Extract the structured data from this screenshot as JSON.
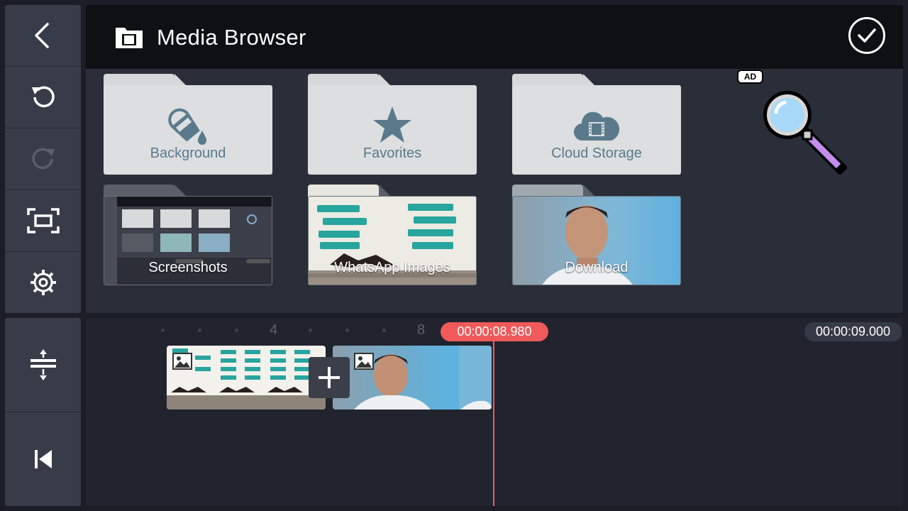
{
  "header": {
    "title": "Media Browser"
  },
  "sidebar": {
    "top_items": [
      {
        "name": "back",
        "icon": "chevron-left-icon"
      },
      {
        "name": "undo",
        "icon": "undo-icon"
      },
      {
        "name": "redo",
        "icon": "redo-icon"
      },
      {
        "name": "fit-screen",
        "icon": "fit-screen-icon"
      },
      {
        "name": "settings",
        "icon": "gear-icon"
      }
    ],
    "bottom_items": [
      {
        "name": "timeline-expand",
        "icon": "expand-vertical-icon"
      },
      {
        "name": "go-to-start",
        "icon": "skip-to-start-icon"
      }
    ]
  },
  "folders": [
    {
      "label": "Background",
      "icon": "paint-bucket-icon"
    },
    {
      "label": "Favorites",
      "icon": "star-icon"
    },
    {
      "label": "Cloud Storage",
      "icon": "cloud-film-icon"
    },
    {
      "label": "Screenshots",
      "icon": "folder-preview"
    },
    {
      "label": "WhatsApp Images",
      "icon": "folder-preview"
    },
    {
      "label": "Download",
      "icon": "folder-preview"
    }
  ],
  "ad": {
    "badge": "AD",
    "icon": "magnifier-icon"
  },
  "timeline": {
    "ruler_labels": [
      "4",
      "8"
    ],
    "current_time": "00:00:08.980",
    "total_time": "00:00:09.000"
  },
  "colors": {
    "accent": "#f05a5a",
    "folder_label": "#5a7a8c",
    "folder_body": "#dcdedf"
  }
}
